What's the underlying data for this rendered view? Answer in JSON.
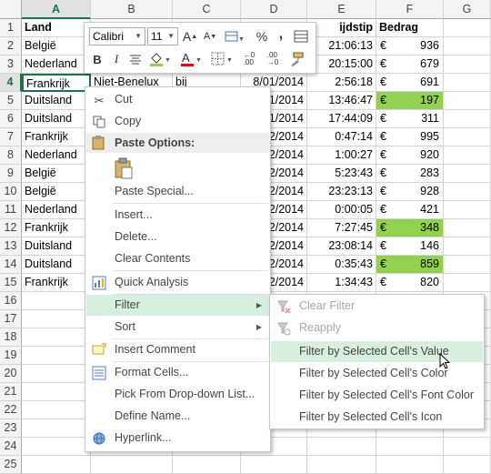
{
  "columns": [
    "A",
    "B",
    "C",
    "D",
    "E",
    "F",
    "G"
  ],
  "rows": [
    {
      "num": "1",
      "a": "Land",
      "b": "",
      "c": "",
      "d": "",
      "e": "ijdstip",
      "cur": "",
      "f": "Bedrag",
      "hl": false,
      "hdr": true
    },
    {
      "num": "2",
      "a": "België",
      "b": "",
      "c": "",
      "d": "",
      "e": "21:06:13",
      "cur": "€",
      "f": "936",
      "hl": false
    },
    {
      "num": "3",
      "a": "Nederland",
      "b": "",
      "c": "",
      "d": "",
      "e": "20:15:00",
      "cur": "€",
      "f": "679",
      "hl": false
    },
    {
      "num": "4",
      "a": "Frankrijk",
      "b": "Niet-Benelux",
      "c": "bij",
      "d": "8/01/2014",
      "e": "2:56:18",
      "cur": "€",
      "f": "691",
      "hl": false
    },
    {
      "num": "5",
      "a": "Duitsland",
      "b": "",
      "c": "",
      "d": "1/2014",
      "e": "13:46:47",
      "cur": "€",
      "f": "197",
      "hl": true
    },
    {
      "num": "6",
      "a": "Duitsland",
      "b": "",
      "c": "",
      "d": "1/2014",
      "e": "17:44:09",
      "cur": "€",
      "f": "311",
      "hl": false
    },
    {
      "num": "7",
      "a": "Frankrijk",
      "b": "",
      "c": "",
      "d": "2/2014",
      "e": "0:47:14",
      "cur": "€",
      "f": "995",
      "hl": false
    },
    {
      "num": "8",
      "a": "Nederland",
      "b": "",
      "c": "",
      "d": "2/2014",
      "e": "1:00:27",
      "cur": "€",
      "f": "920",
      "hl": false
    },
    {
      "num": "9",
      "a": "België",
      "b": "",
      "c": "",
      "d": "2/2014",
      "e": "5:23:43",
      "cur": "€",
      "f": "283",
      "hl": false
    },
    {
      "num": "10",
      "a": "België",
      "b": "",
      "c": "",
      "d": "2/2014",
      "e": "23:23:13",
      "cur": "€",
      "f": "928",
      "hl": false
    },
    {
      "num": "11",
      "a": "Nederland",
      "b": "",
      "c": "",
      "d": "2/2014",
      "e": "0:00:05",
      "cur": "€",
      "f": "421",
      "hl": false
    },
    {
      "num": "12",
      "a": "Frankrijk",
      "b": "",
      "c": "",
      "d": "2/2014",
      "e": "7:27:45",
      "cur": "€",
      "f": "348",
      "hl": true
    },
    {
      "num": "13",
      "a": "Duitsland",
      "b": "",
      "c": "",
      "d": "2/2014",
      "e": "23:08:14",
      "cur": "€",
      "f": "146",
      "hl": false
    },
    {
      "num": "14",
      "a": "Duitsland",
      "b": "",
      "c": "",
      "d": "2/2014",
      "e": "0:35:43",
      "cur": "€",
      "f": "859",
      "hl": true
    },
    {
      "num": "15",
      "a": "Frankrijk",
      "b": "",
      "c": "",
      "d": "2/2014",
      "e": "1:34:43",
      "cur": "€",
      "f": "820",
      "hl": false
    },
    {
      "num": "16",
      "a": "",
      "b": "",
      "c": "",
      "d": "",
      "e": "",
      "cur": "",
      "f": "",
      "hl": false
    },
    {
      "num": "17",
      "a": "",
      "b": "",
      "c": "",
      "d": "",
      "e": "",
      "cur": "",
      "f": "",
      "hl": false
    },
    {
      "num": "18",
      "a": "",
      "b": "",
      "c": "",
      "d": "",
      "e": "",
      "cur": "",
      "f": "",
      "hl": false
    },
    {
      "num": "19",
      "a": "",
      "b": "",
      "c": "",
      "d": "",
      "e": "",
      "cur": "",
      "f": "",
      "hl": false
    },
    {
      "num": "20",
      "a": "",
      "b": "",
      "c": "",
      "d": "",
      "e": "",
      "cur": "",
      "f": "",
      "hl": false
    },
    {
      "num": "21",
      "a": "",
      "b": "",
      "c": "",
      "d": "",
      "e": "",
      "cur": "",
      "f": "",
      "hl": false
    },
    {
      "num": "22",
      "a": "",
      "b": "",
      "c": "",
      "d": "",
      "e": "",
      "cur": "",
      "f": "",
      "hl": false
    },
    {
      "num": "23",
      "a": "",
      "b": "",
      "c": "",
      "d": "",
      "e": "",
      "cur": "",
      "f": "",
      "hl": false
    },
    {
      "num": "24",
      "a": "",
      "b": "",
      "c": "",
      "d": "",
      "e": "",
      "cur": "",
      "f": "",
      "hl": false
    },
    {
      "num": "25",
      "a": "",
      "b": "",
      "c": "",
      "d": "",
      "e": "",
      "cur": "",
      "f": "",
      "hl": false
    }
  ],
  "mini_toolbar": {
    "font_name": "Calibri",
    "font_size": "11",
    "percent": "%",
    "comma": ",",
    "bold": "B",
    "italic": "I",
    "font_color_letter": "A"
  },
  "context_menu": {
    "cut": "Cut",
    "copy": "Copy",
    "paste_options": "Paste Options:",
    "paste_special": "Paste Special...",
    "insert": "Insert...",
    "delete": "Delete...",
    "clear_contents": "Clear Contents",
    "quick_analysis": "Quick Analysis",
    "filter": "Filter",
    "sort": "Sort",
    "insert_comment": "Insert Comment",
    "format_cells": "Format Cells...",
    "pick_from_list": "Pick From Drop-down List...",
    "define_name": "Define Name...",
    "hyperlink": "Hyperlink..."
  },
  "filter_submenu": {
    "clear_filter": "Clear Filter",
    "reapply": "Reapply",
    "by_value": "Filter by Selected Cell's Value",
    "by_color": "Filter by Selected Cell's Color",
    "by_font_color": "Filter by Selected Cell's Font Color",
    "by_icon": "Filter by Selected Cell's Icon"
  },
  "colors": {
    "highlight": "#92d050",
    "excel_green": "#217346",
    "menu_hover": "#d7efdc"
  }
}
